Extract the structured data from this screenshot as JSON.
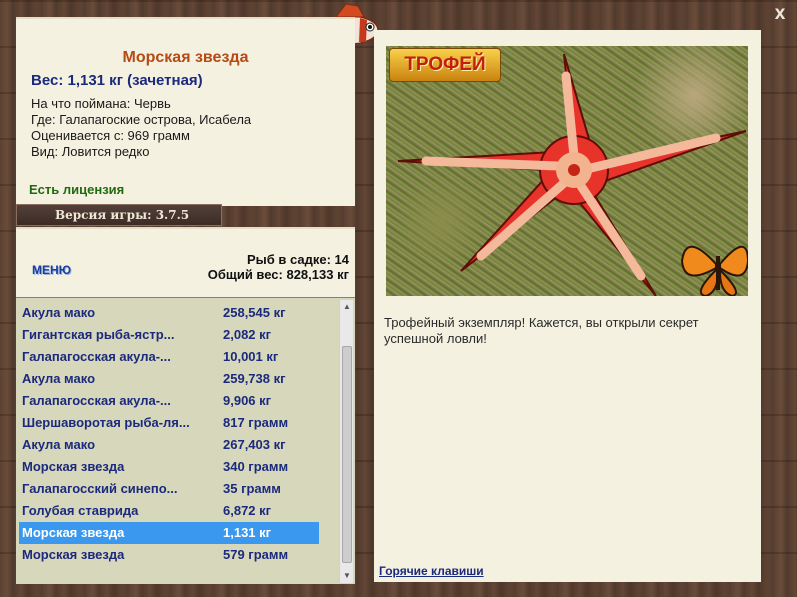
{
  "fish": {
    "name": "Морская звезда",
    "weight_line": "Вес: 1,131 кг (зачетная)",
    "details": [
      "На что поймана: Червь",
      "Где: Галапагоские острова, Исабела",
      "Оценивается с: 969 грамм",
      "Вид: Ловится редко"
    ],
    "license": "Есть лицензия"
  },
  "version": "Версия игры: 3.7.5",
  "menu_label": "МЕНЮ",
  "stats": {
    "fish_count": "Рыб в садке: 14",
    "total_weight": "Общий вес: 828,133 кг"
  },
  "catches": [
    {
      "name": "Акула мако",
      "weight": "258,545 кг"
    },
    {
      "name": "Гигантская рыба-ястр...",
      "weight": "2,082 кг"
    },
    {
      "name": "Галапагосская акула-...",
      "weight": "10,001 кг"
    },
    {
      "name": "Акула мако",
      "weight": "259,738 кг"
    },
    {
      "name": "Галапагосская акула-...",
      "weight": "9,906 кг"
    },
    {
      "name": "Шершаворотая рыба-ля...",
      "weight": "817 грамм"
    },
    {
      "name": "Акула мако",
      "weight": "267,403 кг"
    },
    {
      "name": "Морская звезда",
      "weight": "340 грамм"
    },
    {
      "name": "Галапагосский синепо...",
      "weight": "35 грамм"
    },
    {
      "name": "Голубая ставрида",
      "weight": "6,872 кг"
    },
    {
      "name": "Морская звезда",
      "weight": "1,131 кг",
      "selected": true
    },
    {
      "name": "Морская звезда",
      "weight": "579 грамм"
    }
  ],
  "trophy": {
    "badge": "ТРОФЕЙ",
    "caption": "Трофейный экземпляр! Кажется, вы открыли секрет успешной ловли!"
  },
  "hotkeys_label": "Горячие клавиши",
  "close_symbol": "x",
  "icons": [
    "fish-logo-icon",
    "starfish-image",
    "butterfly-icon",
    "close-icon",
    "scroll-up-icon",
    "scroll-down-icon"
  ],
  "colors": {
    "panel_bg": "#f4f1e1",
    "list_bg": "#d6d7bb",
    "name_color": "#b54a14",
    "link_color": "#1b2a7c",
    "license_color": "#1f6a10",
    "selection": "#3a99ee"
  }
}
